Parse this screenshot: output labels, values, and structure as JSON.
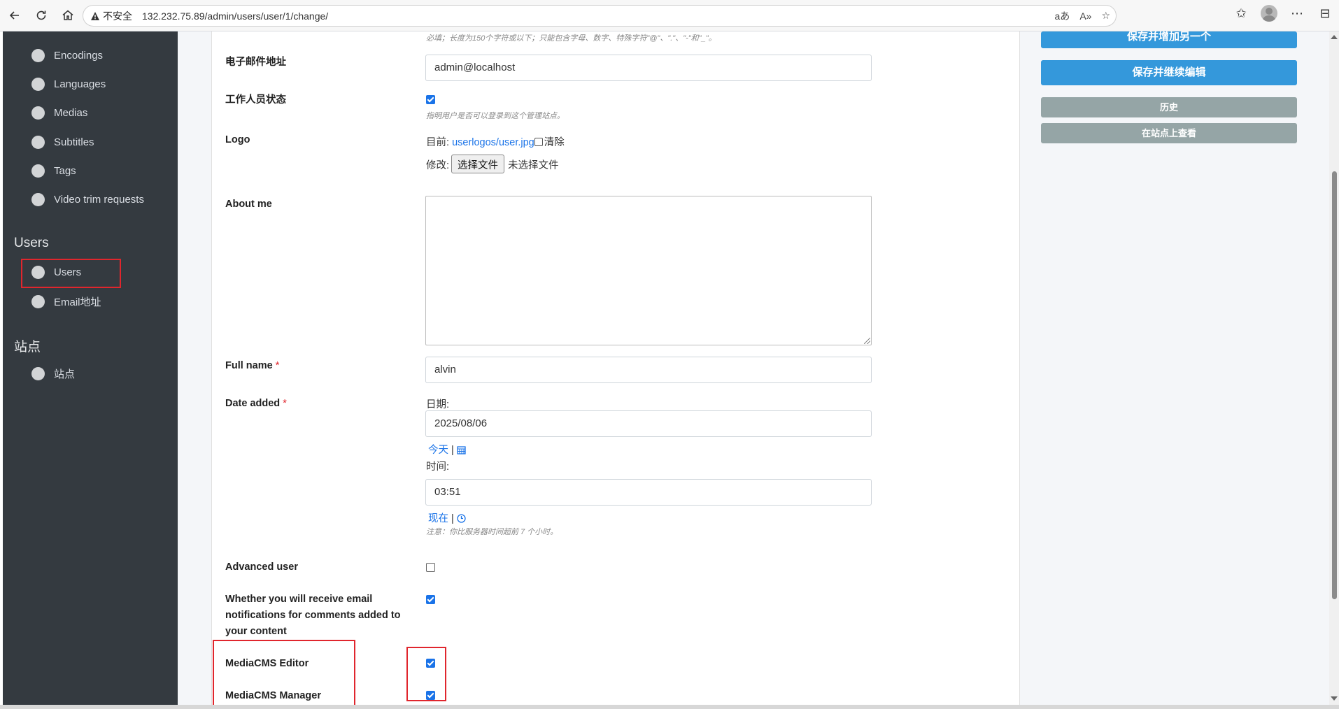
{
  "browser": {
    "security_label": "不安全",
    "url": "132.232.75.89/admin/users/user/1/change/"
  },
  "sidebar": {
    "items_top": [
      {
        "label": "Encodings"
      },
      {
        "label": "Languages"
      },
      {
        "label": "Medias"
      },
      {
        "label": "Subtitles"
      },
      {
        "label": "Tags"
      },
      {
        "label": "Video trim requests"
      }
    ],
    "section_users": "Users",
    "users_items": [
      {
        "label": "Users"
      },
      {
        "label": "Email地址"
      }
    ],
    "section_sites": "站点",
    "sites_items": [
      {
        "label": "站点"
      }
    ]
  },
  "form": {
    "username_help": "必填；长度为150个字符或以下；只能包含字母、数字、特殊字符\"@\"、\".\"、\"-\"和\"_\"。",
    "email": {
      "label": "电子邮件地址",
      "value": "admin@localhost"
    },
    "staff": {
      "label": "工作人员状态",
      "checked": true,
      "help": "指明用户是否可以登录到这个管理站点。"
    },
    "logo": {
      "label": "Logo",
      "current_prefix": "目前:",
      "current_link": "userlogos/user.jpg",
      "clear_label": "清除",
      "change_prefix": "修改:",
      "choose_button": "选择文件",
      "no_file": "未选择文件"
    },
    "about_me": {
      "label": "About me",
      "value": ""
    },
    "full_name": {
      "label": "Full name",
      "required_mark": "*",
      "value": "alvin"
    },
    "date_added": {
      "label": "Date added",
      "required_mark": "*",
      "date_label": "日期:",
      "date_value": "2025/08/06",
      "today_link": "今天",
      "separator": "|",
      "time_label": "时间:",
      "time_value": "03:51",
      "now_link": "现在",
      "timezone_note": "注意：你比服务器时间超前 7 个小时。"
    },
    "advanced_user": {
      "label": "Advanced user",
      "checked": false
    },
    "notify_comments": {
      "label": "Whether you will receive email notifications for comments added to your content",
      "checked": true
    },
    "editor": {
      "label": "MediaCMS Editor",
      "checked": true
    },
    "manager": {
      "label": "MediaCMS Manager",
      "checked": true
    }
  },
  "actions": {
    "save_add_another": "保存并增加另一个",
    "save_continue": "保存并继续编辑",
    "history": "历史",
    "view_on_site": "在站点上查看"
  },
  "colors": {
    "sidebar_bg": "#343a40",
    "primary_button": "#3498db",
    "secondary_button": "#95a5a6",
    "highlight": "#e0262d",
    "link": "#1a73e8"
  }
}
